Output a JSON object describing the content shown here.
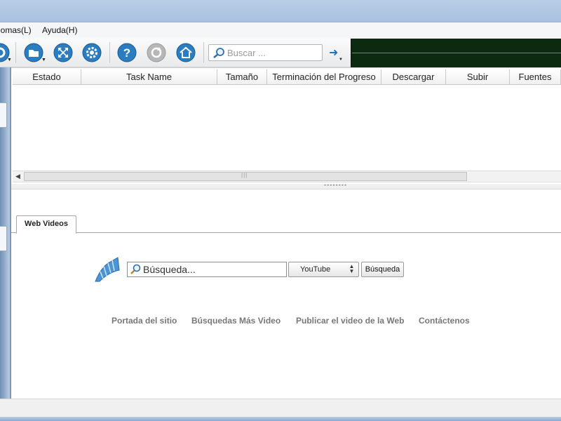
{
  "menu": {
    "items": [
      {
        "label": "iomas(L)"
      },
      {
        "label": "Ayuda(H)"
      }
    ]
  },
  "toolbar": {
    "icons": [
      "options-icon",
      "folder-icon",
      "fullscreen-icon",
      "settings-icon",
      "help-icon",
      "refresh-icon",
      "home-icon"
    ],
    "search_placeholder": "Buscar ...",
    "accent": "#1f73b7",
    "graph_color": "#0b2a0f"
  },
  "table": {
    "columns": [
      "Estado",
      "Task Name",
      "Tamaño",
      "Terminación del Progreso",
      "Descargar",
      "Subir",
      "Fuentes"
    ]
  },
  "lower": {
    "tab_label": "Web Videos",
    "search_placeholder": "Búsqueda...",
    "source_value": "YouTube",
    "search_button": "Búsqueda",
    "links": [
      "Portada del sitio",
      "Búsquedas Más Video",
      "Publicar el video de la Web",
      "Contáctenos"
    ]
  }
}
